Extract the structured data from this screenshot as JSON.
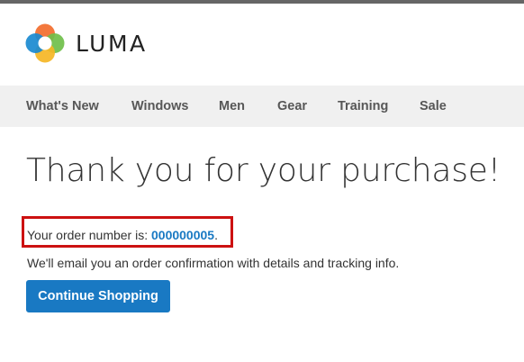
{
  "brand": {
    "name": "LUMA",
    "logo_icon": "luma-logo-icon",
    "colors": {
      "orange": "#f26c2c",
      "yellow": "#f5b625",
      "blue": "#1a8ad0",
      "green": "#6fbf4a",
      "teal": "#2aa5a5"
    }
  },
  "nav": {
    "items": [
      {
        "label": "What's New"
      },
      {
        "label": "Windows"
      },
      {
        "label": "Men"
      },
      {
        "label": "Gear"
      },
      {
        "label": "Training"
      },
      {
        "label": "Sale"
      }
    ]
  },
  "main": {
    "title": "Thank you for your purchase!",
    "order_prefix": "Your order number is: ",
    "order_number": "000000005",
    "order_suffix": ".",
    "email_text": "We'll email you an order confirmation with details and tracking info.",
    "continue_label": "Continue Shopping"
  },
  "colors": {
    "accent": "#1979c3",
    "highlight": "#cc1111",
    "nav_bg": "#f0f0f0"
  }
}
